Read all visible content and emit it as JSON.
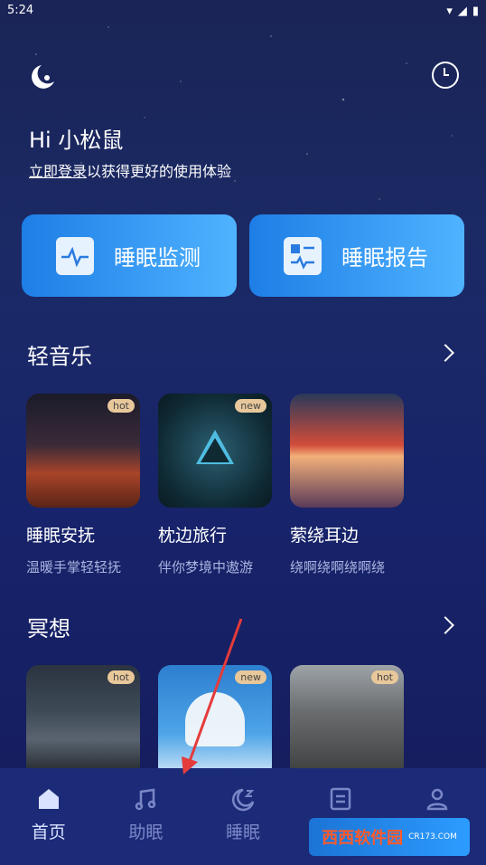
{
  "status": {
    "time": "5:24"
  },
  "greeting": {
    "title": "Hi 小松鼠",
    "login_link": "立即登录",
    "login_rest": "以获得更好的使用体验"
  },
  "cards": [
    {
      "label": "睡眠监测",
      "icon": "monitor-heartbeat-icon"
    },
    {
      "label": "睡眠报告",
      "icon": "report-icon"
    }
  ],
  "sections": [
    {
      "title": "轻音乐",
      "items": [
        {
          "badge": "hot",
          "title": "睡眠安抚",
          "subtitle": "温暖手掌轻轻抚"
        },
        {
          "badge": "new",
          "title": "枕边旅行",
          "subtitle": "伴你梦境中遨游"
        },
        {
          "badge": "",
          "title": "萦绕耳边",
          "subtitle": "绕啊绕啊绕啊绕"
        }
      ]
    },
    {
      "title": "冥想",
      "items": [
        {
          "badge": "hot",
          "title": "",
          "subtitle": ""
        },
        {
          "badge": "new",
          "title": "",
          "subtitle": ""
        },
        {
          "badge": "hot",
          "title": "",
          "subtitle": ""
        }
      ]
    }
  ],
  "tabs": [
    {
      "label": "首页",
      "icon": "home-icon",
      "active": true
    },
    {
      "label": "助眠",
      "icon": "music-icon",
      "active": false
    },
    {
      "label": "睡眠",
      "icon": "moon-zz-icon",
      "active": false
    },
    {
      "label": "",
      "icon": "document-icon",
      "active": false
    },
    {
      "label": "",
      "icon": "user-icon",
      "active": false
    }
  ],
  "watermark": {
    "text": "西西软件园",
    "sub": "CR173.COM"
  },
  "colors": {
    "card_start": "#1e7ee6",
    "card_end": "#4fb3ff",
    "badge": "#e8c89b",
    "tab_bar": "#1c2b78"
  }
}
